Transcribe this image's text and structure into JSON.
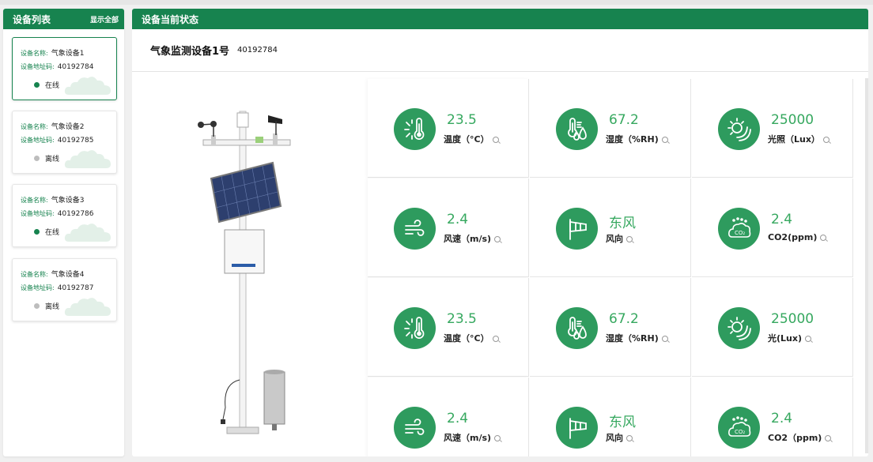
{
  "device_list": {
    "title": "设备列表",
    "show_all": "显示全部",
    "name_label": "设备名称:",
    "addr_label": "设备地址码:",
    "items": [
      {
        "name": "气象设备1",
        "addr": "40192784",
        "status": "在线",
        "online": true
      },
      {
        "name": "气象设备2",
        "addr": "40192785",
        "status": "离线",
        "online": false
      },
      {
        "name": "气象设备3",
        "addr": "40192786",
        "status": "在线",
        "online": true
      },
      {
        "name": "气象设备4",
        "addr": "40192787",
        "status": "离线",
        "online": false
      }
    ]
  },
  "status_panel": {
    "title": "设备当前状态",
    "device_name": "气象监测设备1号",
    "device_addr": "40192784"
  },
  "sensors": [
    {
      "value": "23.5",
      "label": "温度（°C）",
      "icon": "thermometer-icon"
    },
    {
      "value": "67.2",
      "label": "湿度（%RH)",
      "icon": "humidity-icon"
    },
    {
      "value": "25000",
      "label": "光照（Lux）",
      "icon": "sun-icon"
    },
    {
      "value": "2.4",
      "label": "风速（m/s)",
      "icon": "wind-icon"
    },
    {
      "value": "东风",
      "label": "风向",
      "icon": "windsock-icon"
    },
    {
      "value": "2.4",
      "label": "CO2(ppm)",
      "icon": "co2-icon"
    },
    {
      "value": "23.5",
      "label": "温度（°C）",
      "icon": "thermometer-icon"
    },
    {
      "value": "67.2",
      "label": "湿度（%RH)",
      "icon": "humidity-icon"
    },
    {
      "value": "25000",
      "label": "光(Lux)",
      "icon": "sun-icon"
    },
    {
      "value": "2.4",
      "label": "风速（m/s)",
      "icon": "wind-icon"
    },
    {
      "value": "东风",
      "label": "风向",
      "icon": "windsock-icon"
    },
    {
      "value": "2.4",
      "label": "CO2（ppm)",
      "icon": "co2-icon"
    }
  ],
  "colors": {
    "brand": "#17834f",
    "value": "#36a85f",
    "icon_bg": "#2e9b5e"
  }
}
